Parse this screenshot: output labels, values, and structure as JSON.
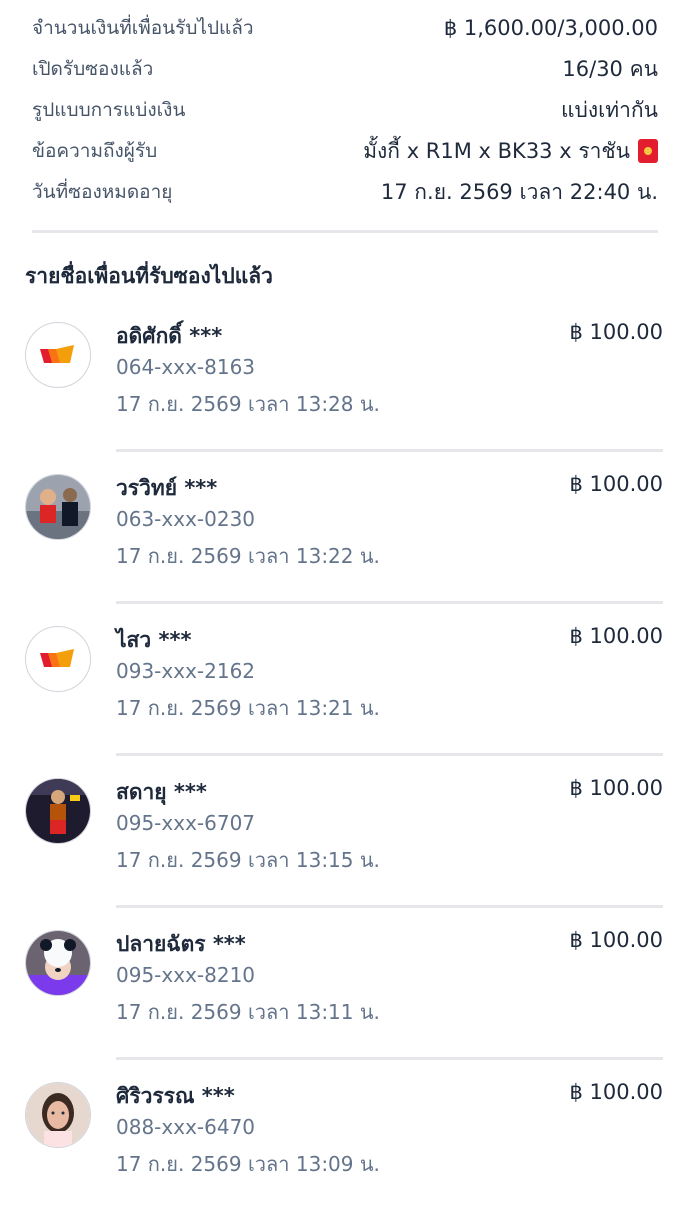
{
  "summary": [
    {
      "label": "จำนวนเงินที่เพื่อนรับไปแล้ว",
      "value": "฿ 1,600.00/3,000.00"
    },
    {
      "label": "เปิดรับซองแล้ว",
      "value": "16/30 คน"
    },
    {
      "label": "รูปแบบการแบ่งเงิน",
      "value": "แบ่งเท่ากัน"
    },
    {
      "label": "ข้อความถึงผู้รับ",
      "value": "มั้งกี้ x R1M x BK33 x ราชัน"
    },
    {
      "label": "วันที่ซองหมดอายุ",
      "value": "17 ก.ย. 2569 เวลา 22:40 น."
    }
  ],
  "section_title": "รายชื่อเพื่อนที่รับซองไปแล้ว",
  "recipients": [
    {
      "name": "อดิศักดิ์ ***",
      "phone": "064-xxx-8163",
      "time": "17 ก.ย. 2569 เวลา 13:28 น.",
      "amount": "฿ 100.00",
      "avatar": "wallet-logo"
    },
    {
      "name": "วรวิทย์ ***",
      "phone": "063-xxx-0230",
      "time": "17 ก.ย. 2569 เวลา 13:22 น.",
      "amount": "฿ 100.00",
      "avatar": "photo"
    },
    {
      "name": "ไสว ***",
      "phone": "093-xxx-2162",
      "time": "17 ก.ย. 2569 เวลา 13:21 น.",
      "amount": "฿ 100.00",
      "avatar": "wallet-logo"
    },
    {
      "name": "สดายุ ***",
      "phone": "095-xxx-6707",
      "time": "17 ก.ย. 2569 เวลา 13:15 น.",
      "amount": "฿ 100.00",
      "avatar": "photo"
    },
    {
      "name": "ปลายฉัตร ***",
      "phone": "095-xxx-8210",
      "time": "17 ก.ย. 2569 เวลา 13:11 น.",
      "amount": "฿ 100.00",
      "avatar": "photo"
    },
    {
      "name": "ศิริวรรณ ***",
      "phone": "088-xxx-6470",
      "time": "17 ก.ย. 2569 เวลา 13:09 น.",
      "amount": "฿ 100.00",
      "avatar": "photo"
    }
  ],
  "colors": {
    "logo_orange": "#f97316",
    "logo_red": "#e11d2e",
    "divider": "#e5e7eb"
  }
}
